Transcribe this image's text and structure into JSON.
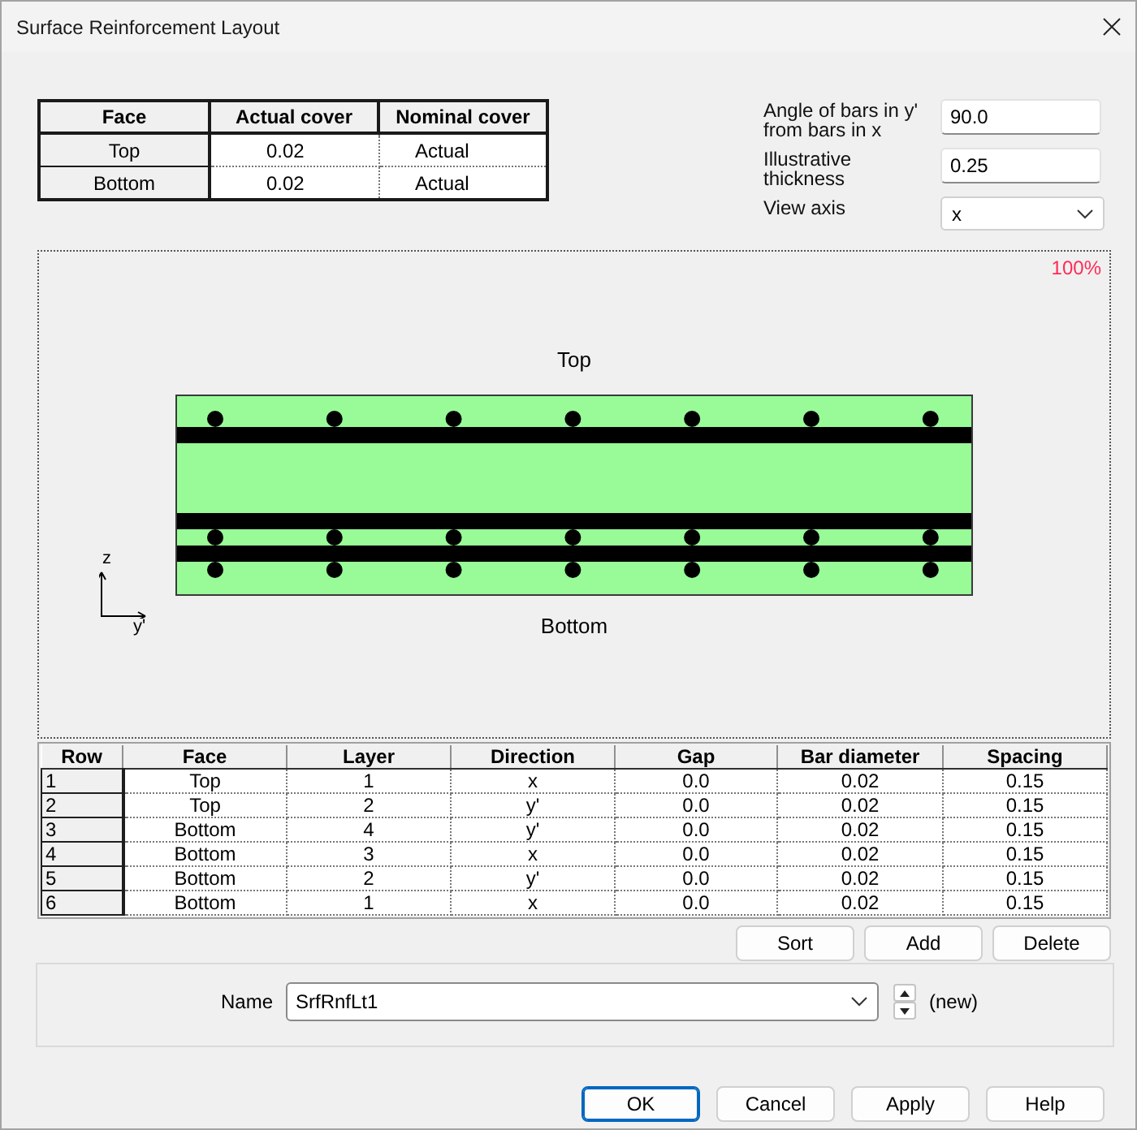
{
  "window": {
    "title": "Surface Reinforcement Layout"
  },
  "cover_table": {
    "columns": [
      "Face",
      "Actual cover",
      "Nominal cover"
    ],
    "rows": [
      [
        "Top",
        "0.02",
        "Actual"
      ],
      [
        "Bottom",
        "0.02",
        "Actual"
      ]
    ]
  },
  "settings": [
    {
      "kind": "text",
      "label": "Angle of bars in y' from bars in x",
      "value": "90.0"
    },
    {
      "kind": "text",
      "label": "Illustrative thickness",
      "value": "0.25"
    },
    {
      "kind": "dropdown",
      "label": "View axis",
      "value": "x"
    }
  ],
  "preview": {
    "zoom": "100%",
    "top_label": "Top",
    "bottom_label": "Bottom",
    "axis_vertical": "z",
    "axis_horizontal": "y'"
  },
  "layer_table": {
    "columns": [
      "Row",
      "Face",
      "Layer",
      "Direction",
      "Gap",
      "Bar diameter",
      "Spacing"
    ],
    "rows": [
      [
        "1",
        "Top",
        "1",
        "x",
        "0.0",
        "0.02",
        "0.15"
      ],
      [
        "2",
        "Top",
        "2",
        "y'",
        "0.0",
        "0.02",
        "0.15"
      ],
      [
        "3",
        "Bottom",
        "4",
        "y'",
        "0.0",
        "0.02",
        "0.15"
      ],
      [
        "4",
        "Bottom",
        "3",
        "x",
        "0.0",
        "0.02",
        "0.15"
      ],
      [
        "5",
        "Bottom",
        "2",
        "y'",
        "0.0",
        "0.02",
        "0.15"
      ],
      [
        "6",
        "Bottom",
        "1",
        "x",
        "0.0",
        "0.02",
        "0.15"
      ]
    ]
  },
  "table_buttons": [
    "Sort",
    "Add",
    "Delete"
  ],
  "name_field": {
    "label": "Name",
    "value": "SrfRnfLt1",
    "status": "(new)"
  },
  "buttons": [
    {
      "label": "OK",
      "default": true
    },
    {
      "label": "Cancel",
      "default": false
    },
    {
      "label": "Apply",
      "default": false
    },
    {
      "label": "Help",
      "default": false
    }
  ]
}
